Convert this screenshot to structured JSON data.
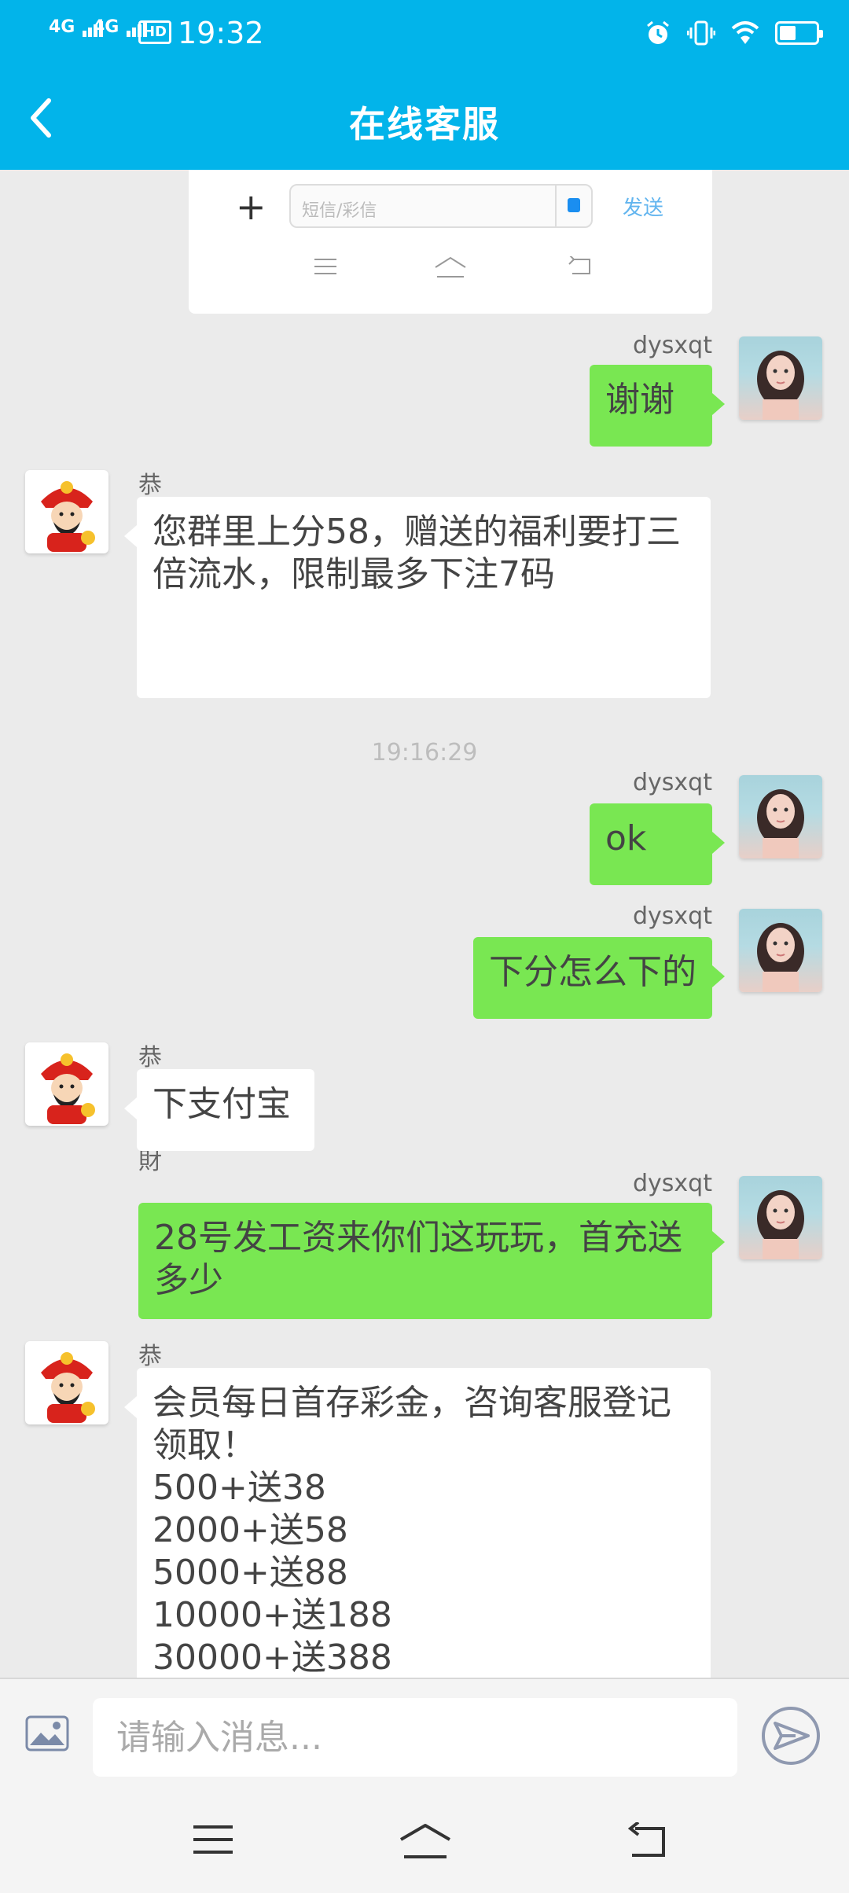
{
  "status_bar": {
    "signal1": "4G",
    "signal2": "4G",
    "hd": "HD",
    "time": "19:32",
    "battery_level": 0.45
  },
  "header": {
    "title": "在线客服",
    "back_icon": "chevron-left-icon"
  },
  "embedded_screenshot": {
    "input_placeholder": "短信/彩信",
    "send_label": "发送"
  },
  "messages": [
    {
      "from": "me",
      "name": "dysxqt",
      "text": "谢谢"
    },
    {
      "from": "bot",
      "name": "恭喜發財",
      "text": "您群里上分58，赠送的福利要打三倍流水，限制最多下注7码"
    },
    {
      "timestamp": "19:16:29"
    },
    {
      "from": "me",
      "name": "dysxqt",
      "text": "ok"
    },
    {
      "from": "me",
      "name": "dysxqt",
      "text": "下分怎么下的"
    },
    {
      "from": "bot",
      "name": "恭喜發財",
      "text": "下支付宝"
    },
    {
      "from": "me",
      "name": "dysxqt",
      "text": "28号发工资来你们这玩玩，首充送多少"
    },
    {
      "from": "bot",
      "name": "恭喜發財",
      "text": "会员每日首存彩金，咨询客服登记领取！\n500+送38\n2000+送58\n5000+送88\n10000+送188\n30000+送388"
    }
  ],
  "input": {
    "placeholder": "请输入消息..."
  },
  "colors": {
    "header_bg": "#02b4ea",
    "my_bubble": "#79e752",
    "their_bubble": "#ffffff",
    "chat_bg": "#ebebeb"
  }
}
